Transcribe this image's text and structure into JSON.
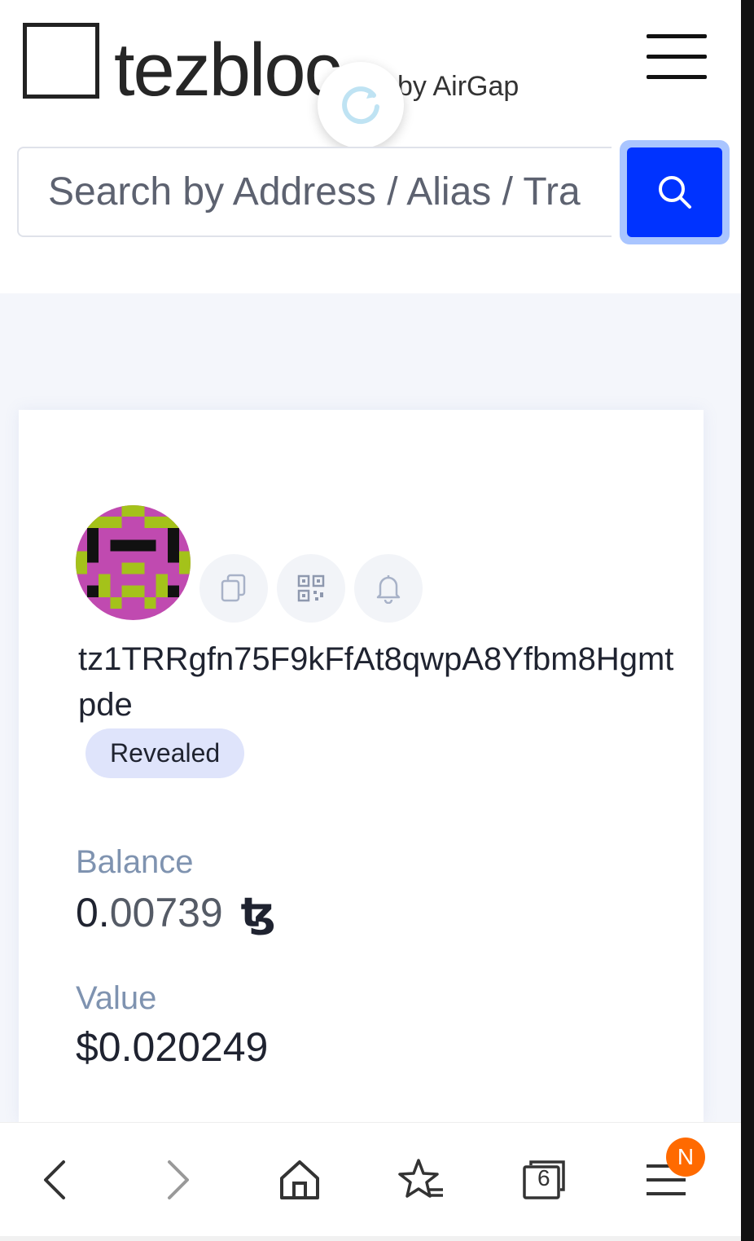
{
  "header": {
    "logo_text": "tezbloc",
    "logo_suffix": "by AirGap"
  },
  "search": {
    "placeholder": "Search by Address / Alias / Tra"
  },
  "account": {
    "address": "tz1TRRgfn75F9kFfAt8qwpA8Yfbm8Hgmtpde",
    "status_badge": "Revealed",
    "balance_label": "Balance",
    "balance_int": "0.",
    "balance_frac": "00739",
    "currency_symbol": "ꜩ",
    "value_label": "Value",
    "value_amount": "$0.020249"
  },
  "browser": {
    "tab_count": "6",
    "notification_badge": "N"
  },
  "colors": {
    "accent": "#0033ff",
    "badge_bg": "#dfe4fb",
    "notification": "#ff6a00",
    "page_bg": "#f4f6fb"
  },
  "icons": [
    "menu-icon",
    "loading-spinner-icon",
    "search-icon",
    "copy-icon",
    "qr-code-icon",
    "bell-icon",
    "back-icon",
    "forward-icon",
    "home-icon",
    "bookmarks-icon",
    "tabs-icon",
    "browser-menu-icon"
  ]
}
